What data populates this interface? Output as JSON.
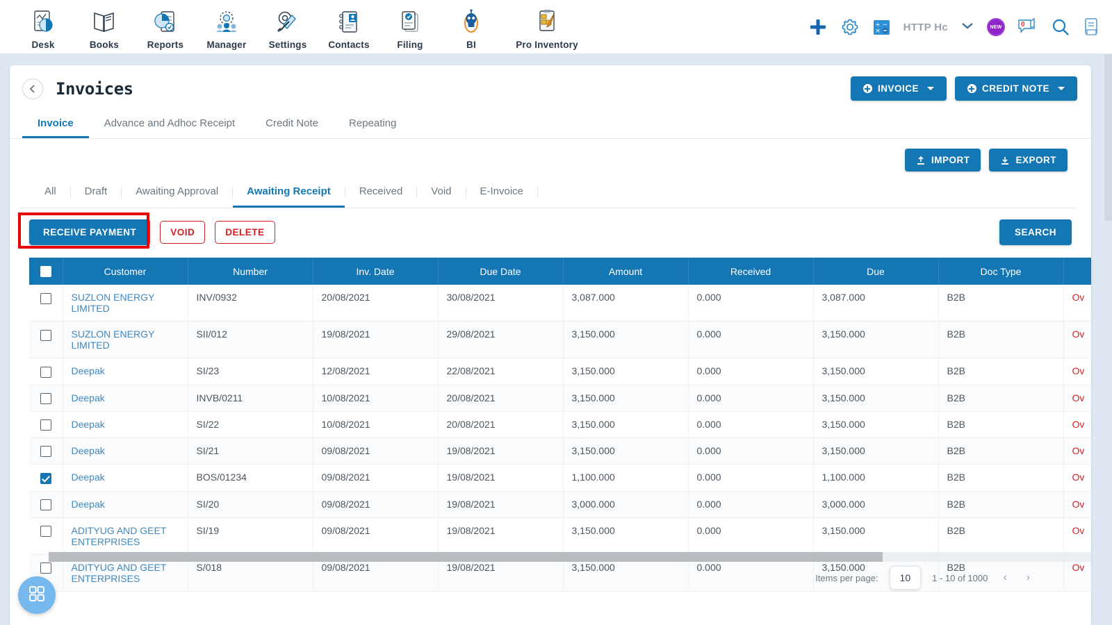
{
  "topnav": {
    "items": [
      {
        "label": "Desk",
        "icon": "desk-chart-icon"
      },
      {
        "label": "Books",
        "icon": "books-icon"
      },
      {
        "label": "Reports",
        "icon": "reports-pie-icon"
      },
      {
        "label": "Manager",
        "icon": "manager-people-icon"
      },
      {
        "label": "Settings",
        "icon": "settings-tools-icon"
      },
      {
        "label": "Contacts",
        "icon": "contacts-book-icon"
      },
      {
        "label": "Filing",
        "icon": "filing-docs-icon"
      },
      {
        "label": "BI",
        "icon": "bi-robot-icon"
      },
      {
        "label": "Pro Inventory",
        "icon": "pro-inventory-icon"
      }
    ],
    "right": {
      "add_icon": "plus-icon",
      "settings_icon": "gear-icon",
      "calculator_icon": "calculator-icon",
      "org_name": "HTTP Hc",
      "chevron_icon": "chevron-down-icon",
      "new_badge": "NEW",
      "chat_icon": "chat-bubble-icon",
      "chat_count": "0",
      "search_icon": "search-icon",
      "notes_icon": "notes-icon"
    }
  },
  "header": {
    "back_icon": "back-chevron-icon",
    "title": "Invoices",
    "invoice_button": "INVOICE",
    "credit_note_button": "CREDIT NOTE"
  },
  "tabs": [
    {
      "label": "Invoice",
      "active": true
    },
    {
      "label": "Advance and Adhoc Receipt",
      "active": false
    },
    {
      "label": "Credit Note",
      "active": false
    },
    {
      "label": "Repeating",
      "active": false
    }
  ],
  "toolbar": {
    "import_label": "IMPORT",
    "export_label": "EXPORT",
    "import_icon": "upload-icon",
    "export_icon": "download-icon"
  },
  "filters": [
    {
      "label": "All",
      "active": false
    },
    {
      "label": "Draft",
      "active": false
    },
    {
      "label": "Awaiting Approval",
      "active": false
    },
    {
      "label": "Awaiting Receipt",
      "active": true
    },
    {
      "label": "Received",
      "active": false
    },
    {
      "label": "Void",
      "active": false
    },
    {
      "label": "E-Invoice",
      "active": false
    }
  ],
  "actions": {
    "receive_payment": "RECEIVE PAYMENT",
    "void": "VOID",
    "delete": "DELETE",
    "search": "SEARCH",
    "highlight_color": "#e80000"
  },
  "table": {
    "columns": [
      "",
      "Customer",
      "Number",
      "Inv. Date",
      "Due Date",
      "Amount",
      "Received",
      "Due",
      "Doc Type",
      ""
    ],
    "select_all_checked": false,
    "rows": [
      {
        "checked": false,
        "customer": "SUZLON ENERGY LIMITED",
        "number": "INV/0932",
        "inv_date": "20/08/2021",
        "due_date": "30/08/2021",
        "amount": "3,087.000",
        "received": "0.000",
        "due": "3,087.000",
        "doc_type": "B2B",
        "status": "Ov"
      },
      {
        "checked": false,
        "customer": "SUZLON ENERGY LIMITED",
        "number": "SII/012",
        "inv_date": "19/08/2021",
        "due_date": "29/08/2021",
        "amount": "3,150.000",
        "received": "0.000",
        "due": "3,150.000",
        "doc_type": "B2B",
        "status": "Ov"
      },
      {
        "checked": false,
        "customer": "Deepak",
        "number": "SI/23",
        "inv_date": "12/08/2021",
        "due_date": "22/08/2021",
        "amount": "3,150.000",
        "received": "0.000",
        "due": "3,150.000",
        "doc_type": "B2B",
        "status": "Ov"
      },
      {
        "checked": false,
        "customer": "Deepak",
        "number": "INVB/0211",
        "inv_date": "10/08/2021",
        "due_date": "20/08/2021",
        "amount": "3,150.000",
        "received": "0.000",
        "due": "3,150.000",
        "doc_type": "B2B",
        "status": "Ov"
      },
      {
        "checked": false,
        "customer": "Deepak",
        "number": "SI/22",
        "inv_date": "10/08/2021",
        "due_date": "20/08/2021",
        "amount": "3,150.000",
        "received": "0.000",
        "due": "3,150.000",
        "doc_type": "B2B",
        "status": "Ov"
      },
      {
        "checked": false,
        "customer": "Deepak",
        "number": "SI/21",
        "inv_date": "09/08/2021",
        "due_date": "19/08/2021",
        "amount": "3,150.000",
        "received": "0.000",
        "due": "3,150.000",
        "doc_type": "B2B",
        "status": "Ov"
      },
      {
        "checked": true,
        "customer": "Deepak",
        "number": "BOS/01234",
        "inv_date": "09/08/2021",
        "due_date": "19/08/2021",
        "amount": "1,100.000",
        "received": "0.000",
        "due": "1,100.000",
        "doc_type": "B2B",
        "status": "Ov"
      },
      {
        "checked": false,
        "customer": "Deepak",
        "number": "SI/20",
        "inv_date": "09/08/2021",
        "due_date": "19/08/2021",
        "amount": "3,000.000",
        "received": "0.000",
        "due": "3,000.000",
        "doc_type": "B2B",
        "status": "Ov"
      },
      {
        "checked": false,
        "customer": "ADITYUG AND GEET ENTERPRISES",
        "number": "SI/19",
        "inv_date": "09/08/2021",
        "due_date": "19/08/2021",
        "amount": "3,150.000",
        "received": "0.000",
        "due": "3,150.000",
        "doc_type": "B2B",
        "status": "Ov"
      },
      {
        "checked": false,
        "customer": "ADITYUG AND GEET ENTERPRISES",
        "number": "S/018",
        "inv_date": "09/08/2021",
        "due_date": "19/08/2021",
        "amount": "3,150.000",
        "received": "0.000",
        "due": "3,150.000",
        "doc_type": "B2B",
        "status": "Ov"
      }
    ]
  },
  "pagination": {
    "items_per_page_label": "Items per page:",
    "items_per_page_value": "10",
    "range_label": "1 - 10 of 1000",
    "prev_icon": "chevron-left-icon",
    "next_icon": "chevron-right-icon"
  },
  "fab": {
    "icon": "grid-apps-icon"
  }
}
